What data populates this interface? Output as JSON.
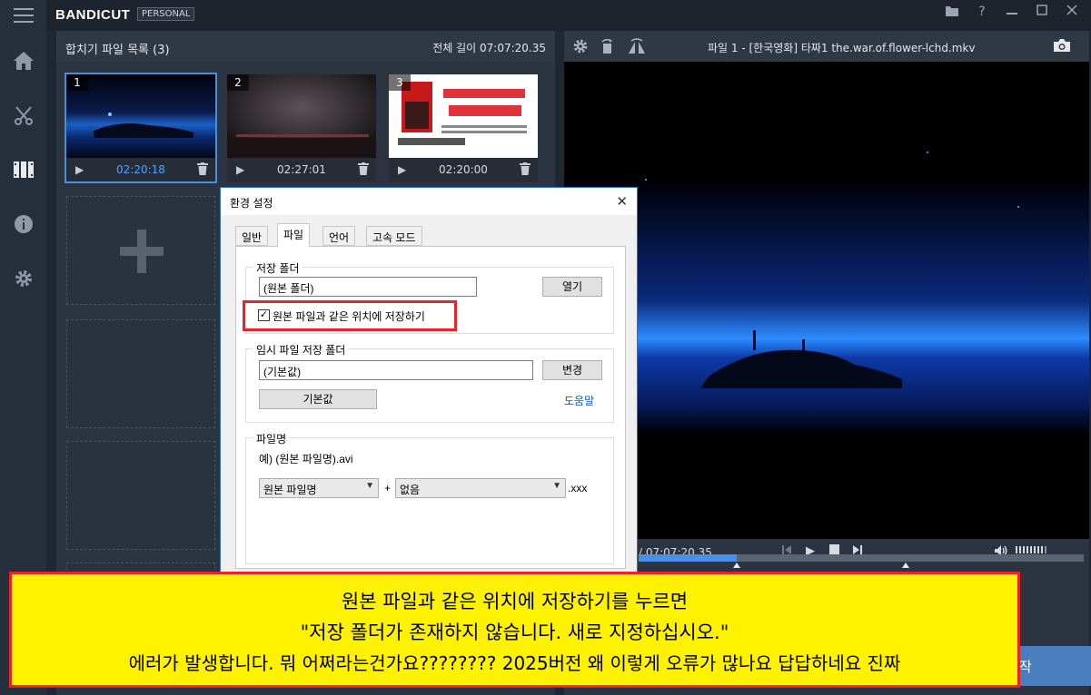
{
  "app": {
    "logo": "BANDICUT",
    "edition": "PERSONAL",
    "colors": {
      "accent": "#4a90d9",
      "highlight": "#e8232a",
      "note_bg": "#fff200"
    }
  },
  "sidebar": {
    "icons": [
      "menu-icon",
      "home-icon",
      "cut-icon",
      "merge-icon",
      "info-icon",
      "settings-icon"
    ]
  },
  "top_controls": [
    "folder-icon",
    "help-icon",
    "minimize-icon",
    "maximize-icon",
    "close-icon"
  ],
  "merge_list": {
    "title": "합치기 파일 목록 (3)",
    "total_label": "전체 길이 07:07:20.35",
    "items": [
      {
        "num": "1",
        "duration": "02:20:18"
      },
      {
        "num": "2",
        "duration": "02:27:01"
      },
      {
        "num": "3",
        "duration": "02:20:00"
      }
    ]
  },
  "preview": {
    "file_title": "파일 1 - [한국영화] 타짜1 the.war.of.flower-lchd.mkv",
    "time_text": "/ 07:07:20.35",
    "progress": 0.22,
    "markers": [
      0.22,
      0.6
    ]
  },
  "start_button": {
    "label": "작"
  },
  "dialog": {
    "title": "환경 설정",
    "tabs": [
      "일반",
      "파일",
      "언어",
      "고속 모드"
    ],
    "active_tab": "파일",
    "save_folder": {
      "label": "저장 폴더",
      "value": "(원본 폴더)",
      "open_button": "열기",
      "checkbox_label": "원본 파일과 같은 위치에 저장하기",
      "checked": true
    },
    "temp_folder": {
      "label": "임시 파일 저장 폴더",
      "value": "(기본값)",
      "change_button": "변경",
      "default_button": "기본값",
      "help_link": "도움말"
    },
    "filename": {
      "label": "파일명",
      "example": "예) (원본 파일명).avi",
      "select1": "원본 파일명",
      "plus": "+",
      "select2": "없음",
      "suffix": ".xxx"
    }
  },
  "annotation": {
    "line1": "원본 파일과 같은 위치에 저장하기를 누르면",
    "line2": "\"저장 폴더가 존재하지 않습니다. 새로 지정하십시오.\"",
    "line3": "에러가 발생합니다. 뭐 어쩌라는건가요???????? 2025버전 왜 이렇게 오류가 많나요 답답하네요 진짜"
  }
}
